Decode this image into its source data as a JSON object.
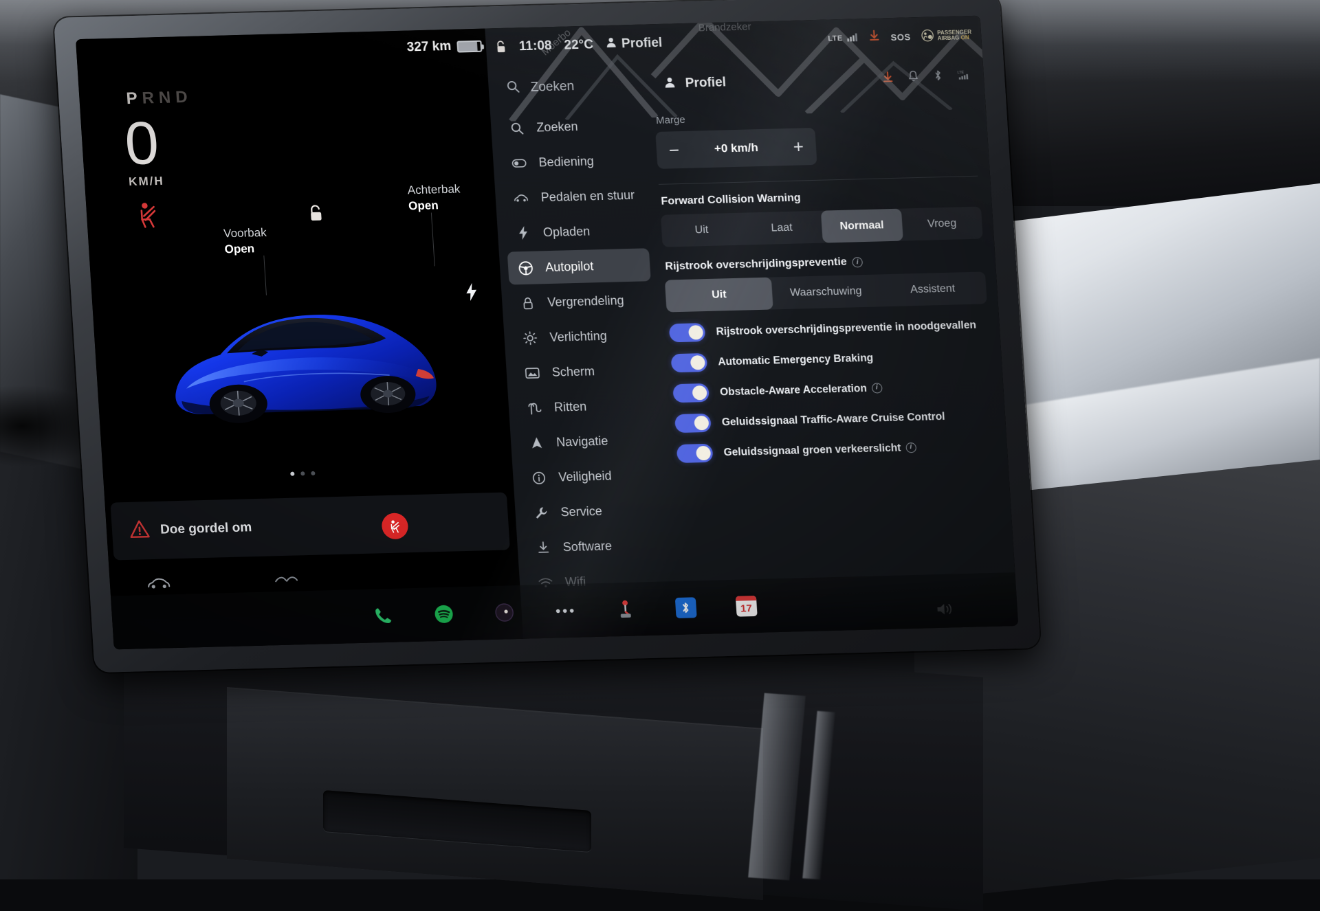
{
  "cluster": {
    "gear_display": "PRND",
    "gear_selected": "P",
    "speed": "0",
    "speed_unit": "KM/H",
    "front_trunk_label": "Voorbak",
    "front_trunk_state": "Open",
    "rear_trunk_label": "Achterbak",
    "rear_trunk_state": "Open",
    "alert_text": "Doe gordel om",
    "page_dot_count": 3,
    "page_dot_active": 0,
    "icons": {
      "seatbelt_warning": "seatbelt-warning-icon",
      "unlock": "unlock-icon",
      "charge_port": "charge-bolt-icon",
      "car_view": "car-icon",
      "wiper": "wiper-icon"
    }
  },
  "status_bar": {
    "range": "327 km",
    "lock_icon": "unlock-icon",
    "time": "11:08",
    "temperature": "22°C",
    "profile": "Profiel",
    "lte_label": "LTE",
    "sos_label": "SOS",
    "airbag_line1": "PASSENGER",
    "airbag_line2": "AIRBAG",
    "airbag_status": "ON",
    "icons": {
      "person": "person-icon",
      "signal": "signal-bars-icon",
      "download": "download-icon",
      "sos": "sos-icon",
      "airbag": "airbag-icon"
    }
  },
  "panel_header": {
    "search_label": "Zoeken",
    "profile_label": "Profiel",
    "icons": {
      "search": "search-icon",
      "person": "person-icon",
      "download": "download-icon",
      "bell": "bell-icon",
      "bluetooth": "bluetooth-icon",
      "lte": "lte-icon"
    }
  },
  "sidebar": {
    "items": [
      {
        "label": "Zoeken",
        "icon": "search-icon",
        "active": false
      },
      {
        "label": "Bediening",
        "icon": "toggle-icon",
        "active": false
      },
      {
        "label": "Pedalen en stuur",
        "icon": "car-icon",
        "active": false
      },
      {
        "label": "Opladen",
        "icon": "bolt-icon",
        "active": false
      },
      {
        "label": "Autopilot",
        "icon": "steering-wheel-icon",
        "active": true
      },
      {
        "label": "Vergrendeling",
        "icon": "lock-icon",
        "active": false
      },
      {
        "label": "Verlichting",
        "icon": "light-icon",
        "active": false
      },
      {
        "label": "Scherm",
        "icon": "screen-icon",
        "active": false
      },
      {
        "label": "Ritten",
        "icon": "road-icon",
        "active": false
      },
      {
        "label": "Navigatie",
        "icon": "navigation-icon",
        "active": false
      },
      {
        "label": "Veiligheid",
        "icon": "info-circle-icon",
        "active": false
      },
      {
        "label": "Service",
        "icon": "wrench-icon",
        "active": false
      },
      {
        "label": "Software",
        "icon": "download-icon",
        "active": false
      },
      {
        "label": "Wifi",
        "icon": "wifi-icon",
        "active": false
      }
    ]
  },
  "settings": {
    "margin": {
      "label": "Marge",
      "value": "+0 km/h",
      "minus_label": "−",
      "plus_label": "+"
    },
    "forward_collision_warning": {
      "title": "Forward Collision Warning",
      "options": [
        "Uit",
        "Laat",
        "Normaal",
        "Vroeg"
      ],
      "selected": "Normaal"
    },
    "lane_departure": {
      "title": "Rijstrook overschrijdingspreventie",
      "options": [
        "Uit",
        "Waarschuwing",
        "Assistent"
      ],
      "selected": "Uit",
      "has_info": true
    },
    "toggles": [
      {
        "label": "Rijstrook overschrijdingspreventie in noodgevallen",
        "on": true,
        "has_info": false
      },
      {
        "label": "Automatic Emergency Braking",
        "on": true,
        "has_info": false
      },
      {
        "label": "Obstacle-Aware Acceleration",
        "on": true,
        "has_info": true
      },
      {
        "label": "Geluidssignaal Traffic-Aware Cruise Control",
        "on": true,
        "has_info": false
      },
      {
        "label": "Geluidssignaal groen verkeerslicht",
        "on": true,
        "has_info": true
      }
    ],
    "volume_icon": "speaker-icon"
  },
  "dock": {
    "items": [
      {
        "name": "phone-app",
        "icon": "phone-icon"
      },
      {
        "name": "spotify-app",
        "icon": "spotify-icon"
      },
      {
        "name": "media-app",
        "icon": "disc-icon"
      },
      {
        "name": "more-apps",
        "icon": "ellipsis-icon"
      },
      {
        "name": "toybox-app",
        "icon": "joystick-icon"
      },
      {
        "name": "bluetooth-app",
        "icon": "bluetooth-icon"
      },
      {
        "name": "calendar-app",
        "icon": "calendar-icon",
        "day": "17"
      }
    ]
  },
  "map_labels": {
    "place_1": "Moerbo",
    "place_2": "Brandzeker"
  },
  "colors": {
    "toggle_on": "#4f63e0",
    "accent_red": "#dc2626",
    "selected_pill": "rgba(125,131,141,.55)",
    "car_blue": "#1436e8"
  }
}
